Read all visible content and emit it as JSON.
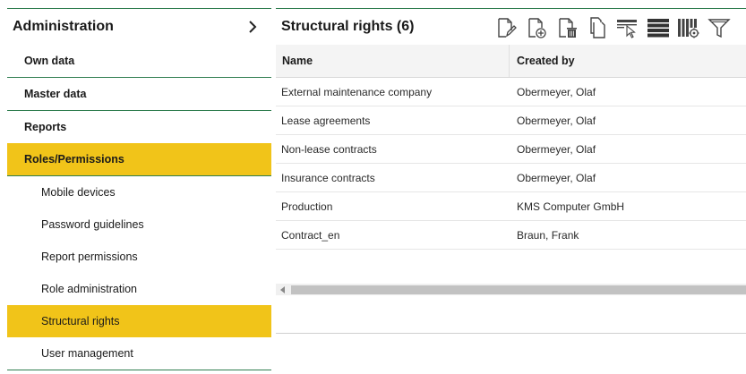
{
  "sidebar": {
    "title": "Administration",
    "items": [
      {
        "label": "Own data"
      },
      {
        "label": "Master data"
      },
      {
        "label": "Reports"
      },
      {
        "label": "Roles/Permissions"
      },
      {
        "label": "Mobile devices"
      },
      {
        "label": "Password guidelines"
      },
      {
        "label": "Report permissions"
      },
      {
        "label": "Role administration"
      },
      {
        "label": "Structural rights"
      },
      {
        "label": "User management"
      }
    ],
    "active_color": "#f1c419",
    "divider_color": "#2f7d4f"
  },
  "main": {
    "title": "Structural rights (6)",
    "toolbar": [
      "edit-document-icon",
      "add-document-icon",
      "delete-document-icon",
      "copy-document-icon",
      "select-column-icon",
      "rows-icon",
      "column-settings-icon",
      "filter-icon"
    ],
    "columns": {
      "name": "Name",
      "created": "Created by"
    },
    "rows": [
      {
        "name": "External maintenance company",
        "created": "Obermeyer, Olaf"
      },
      {
        "name": "Lease agreements",
        "created": "Obermeyer, Olaf"
      },
      {
        "name": "Non-lease contracts",
        "created": "Obermeyer, Olaf"
      },
      {
        "name": "Insurance contracts",
        "created": "Obermeyer, Olaf"
      },
      {
        "name": "Production",
        "created": "KMS Computer GmbH"
      },
      {
        "name": "Contract_en",
        "created": "Braun, Frank"
      }
    ]
  }
}
